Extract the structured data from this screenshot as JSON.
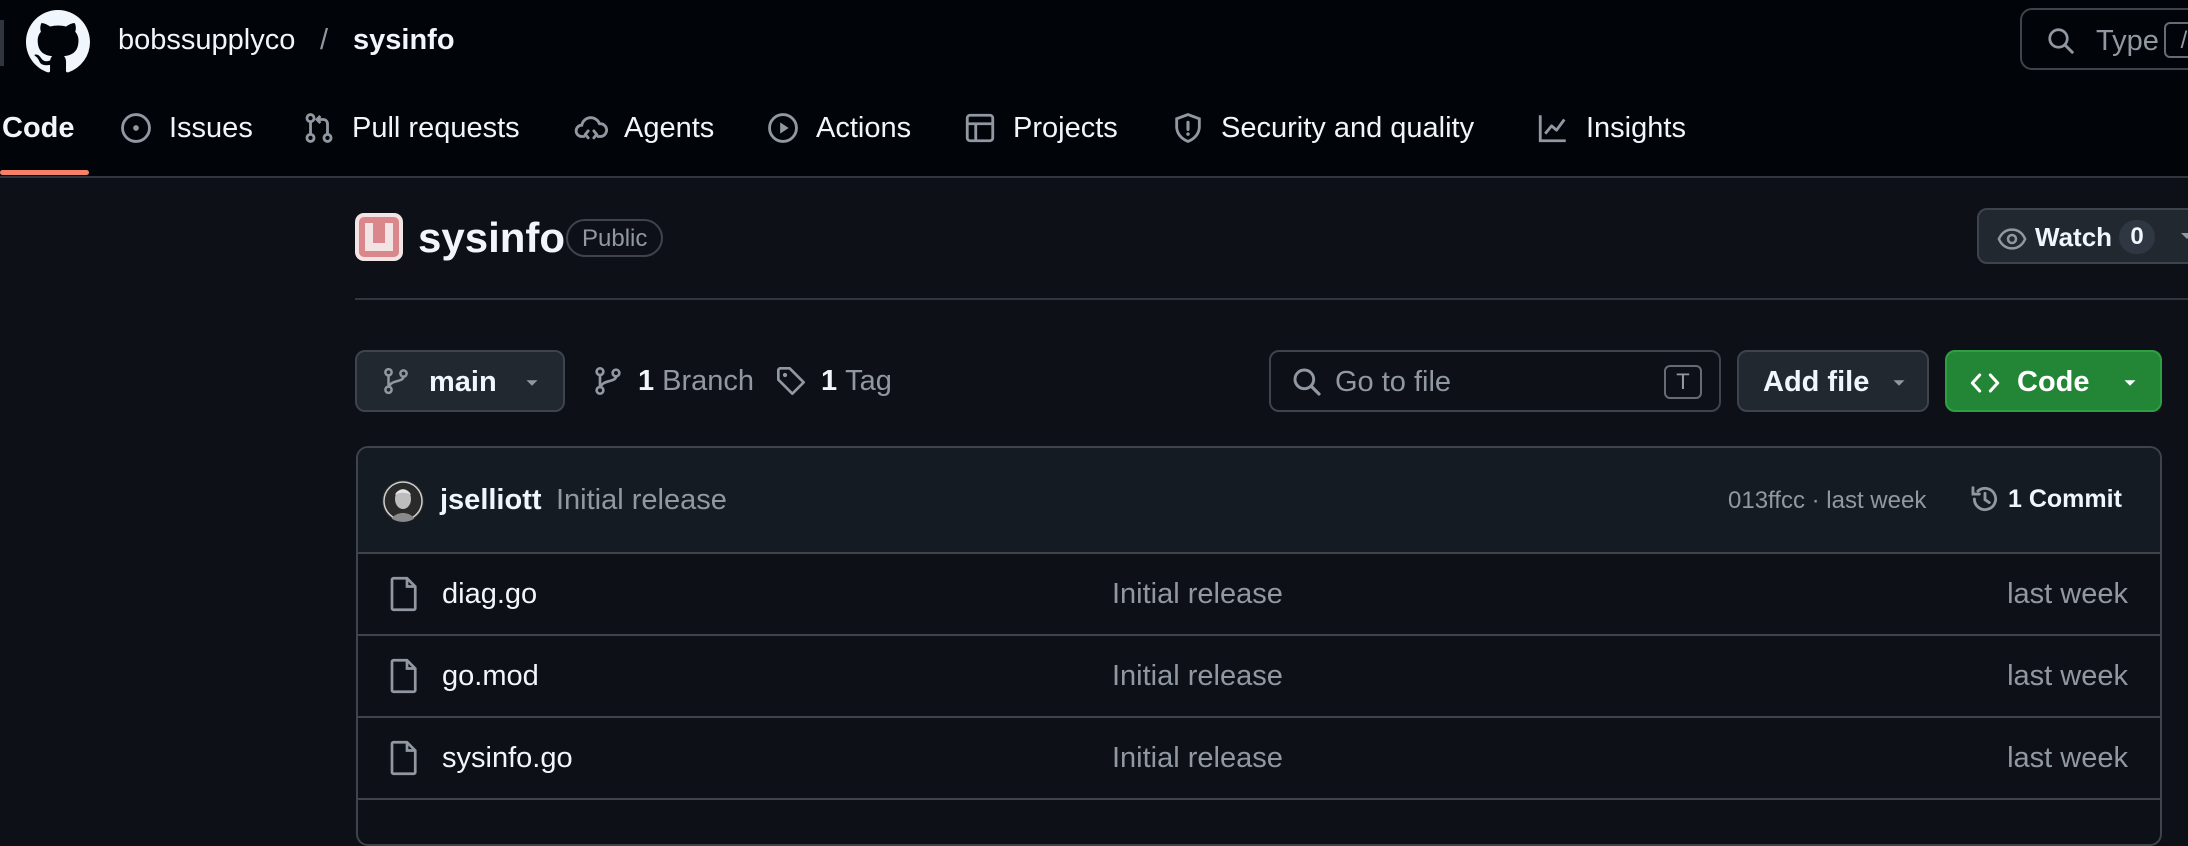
{
  "header": {
    "owner": "bobssupplyco",
    "separator": "/",
    "repo": "sysinfo",
    "search_placeholder": "Type",
    "search_shortcut": "/"
  },
  "nav": {
    "tabs": [
      {
        "label": "Code",
        "icon": "code-icon",
        "active": true
      },
      {
        "label": "Issues",
        "icon": "issue-icon"
      },
      {
        "label": "Pull requests",
        "icon": "pull-request-icon"
      },
      {
        "label": "Agents",
        "icon": "agent-cloud-icon"
      },
      {
        "label": "Actions",
        "icon": "play-icon"
      },
      {
        "label": "Projects",
        "icon": "table-icon"
      },
      {
        "label": "Security and quality",
        "icon": "shield-icon"
      },
      {
        "label": "Insights",
        "icon": "graph-icon"
      }
    ]
  },
  "repo": {
    "name": "sysinfo",
    "visibility": "Public",
    "watch_label": "Watch",
    "watch_count": "0"
  },
  "toolbar": {
    "branch": "main",
    "branch_count": "1",
    "branch_label": "Branch",
    "tag_count": "1",
    "tag_label": "Tag",
    "go_to_file_placeholder": "Go to file",
    "go_to_file_shortcut": "T",
    "add_file_label": "Add file",
    "code_label": "Code"
  },
  "latest_commit": {
    "author": "jselliott",
    "message": "Initial release",
    "meta": "013ffcc · last week",
    "commits_label": "1 Commit"
  },
  "files": [
    {
      "name": "diag.go",
      "message": "Initial release",
      "age": "last week"
    },
    {
      "name": "go.mod",
      "message": "Initial release",
      "age": "last week"
    },
    {
      "name": "sysinfo.go",
      "message": "Initial release",
      "age": "last week"
    }
  ],
  "colors": {
    "background": "#0d1117",
    "header_bg": "#010409",
    "accent_underline": "#f78166",
    "code_button": "#238636",
    "muted_text": "#9198a1"
  }
}
